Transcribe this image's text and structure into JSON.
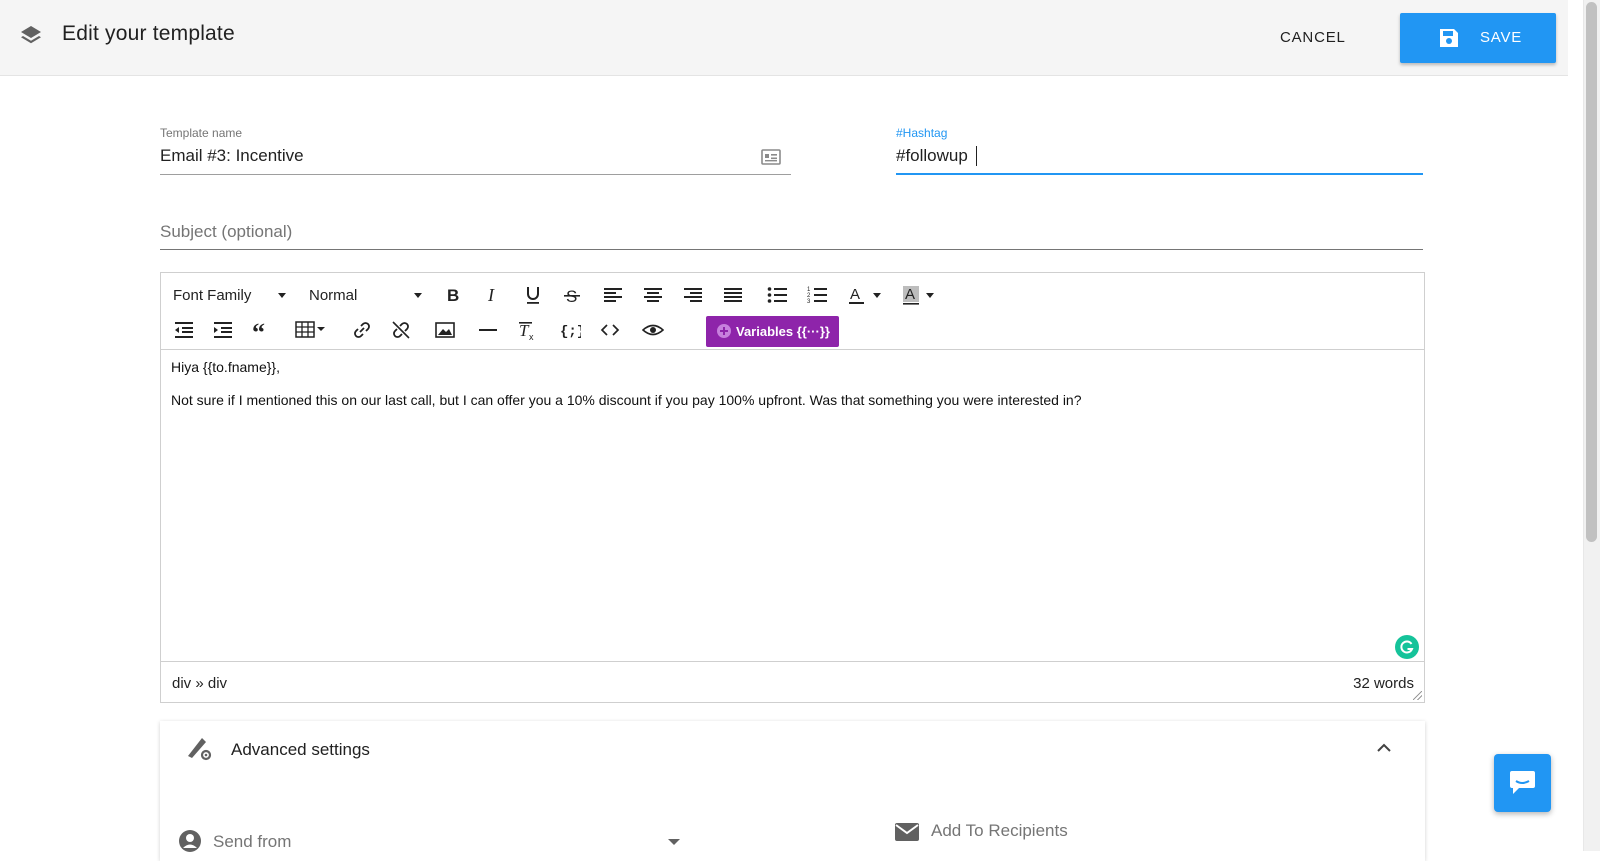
{
  "header": {
    "title": "Edit your template",
    "cancel_label": "CANCEL",
    "save_label": "SAVE",
    "accent_color": "#2196f3"
  },
  "form": {
    "template_name_label": "Template name",
    "template_name_value": "Email #3: Incentive",
    "hashtag_label": "#Hashtag",
    "hashtag_value": "#followup",
    "subject_placeholder": "Subject (optional)"
  },
  "toolbar": {
    "font_family": "Font Family",
    "font_size": "Normal",
    "variables_label": "Variables {{···}}",
    "variables_color": "#8e24aa",
    "icons": [
      "bold-icon",
      "italic-icon",
      "underline-icon",
      "strikethrough-icon",
      "align-left-icon",
      "align-center-icon",
      "align-right-icon",
      "align-justify-icon",
      "bullet-list-icon",
      "numbered-list-icon",
      "text-color-icon",
      "highlight-color-icon",
      "outdent-icon",
      "indent-icon",
      "blockquote-icon",
      "table-icon",
      "link-icon",
      "unlink-icon",
      "image-icon",
      "horizontal-rule-icon",
      "clear-format-icon",
      "code-block-icon",
      "source-code-icon",
      "preview-icon"
    ]
  },
  "editor": {
    "line1": "Hiya {{to.fname}},",
    "line2": "Not sure if I mentioned this on our last call, but I can offer you a 10% discount if you pay 100% upfront. Was that something you were interested in?",
    "path": "div » div",
    "word_count": "32 words"
  },
  "advanced": {
    "title": "Advanced settings",
    "send_from_label": "Send from",
    "add_recipients_label": "Add To Recipients"
  }
}
